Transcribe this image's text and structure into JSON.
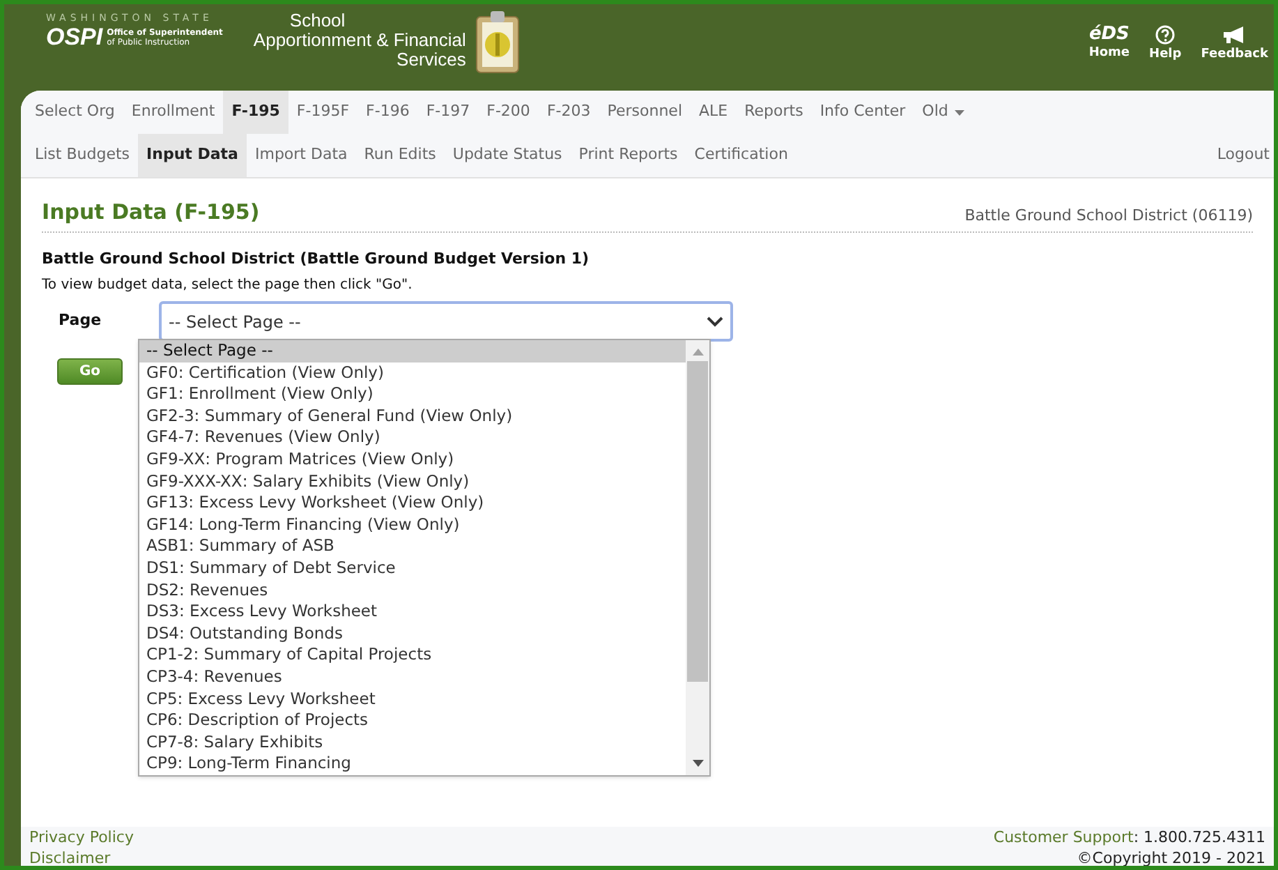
{
  "header": {
    "state_text": "WASHINGTON STATE",
    "logo": "OSPI",
    "agency_lines": [
      "Office of Superintendent",
      "of Public Instruction"
    ],
    "app_title_lines": [
      "School",
      "Apportionment & Financial",
      "Services"
    ],
    "eds_logo": "éDS",
    "links": [
      {
        "label": "Home",
        "kind": "home"
      },
      {
        "label": "Help",
        "kind": "help"
      },
      {
        "label": "Feedback",
        "kind": "feedback"
      }
    ]
  },
  "nav": [
    {
      "label": "Select Org",
      "selected": false
    },
    {
      "label": "Enrollment",
      "selected": false
    },
    {
      "label": "F-195",
      "selected": true
    },
    {
      "label": "F-195F",
      "selected": false
    },
    {
      "label": "F-196",
      "selected": false
    },
    {
      "label": "F-197",
      "selected": false
    },
    {
      "label": "F-200",
      "selected": false
    },
    {
      "label": "F-203",
      "selected": false
    },
    {
      "label": "Personnel",
      "selected": false
    },
    {
      "label": "ALE",
      "selected": false
    },
    {
      "label": "Reports",
      "selected": false
    },
    {
      "label": "Info Center",
      "selected": false
    },
    {
      "label": "Old",
      "selected": false,
      "menu": true
    }
  ],
  "subnav": [
    {
      "label": "List Budgets",
      "selected": false
    },
    {
      "label": "Input Data",
      "selected": true
    },
    {
      "label": "Import Data",
      "selected": false
    },
    {
      "label": "Run Edits",
      "selected": false
    },
    {
      "label": "Update Status",
      "selected": false
    },
    {
      "label": "Print Reports",
      "selected": false
    },
    {
      "label": "Certification",
      "selected": false
    }
  ],
  "logout": "Logout",
  "page": {
    "title": "Input Data (F-195)",
    "district": "Battle Ground School District (06119)",
    "budget": "Battle Ground School District (Battle Ground Budget Version 1)",
    "instruction": "To view budget data, select the page then click \"Go\".",
    "field_label": "Page",
    "select_value": "-- Select Page --",
    "go": "Go",
    "options": [
      {
        "label": "-- Select Page --",
        "selected": true
      },
      {
        "label": "GF0: Certification (View Only)",
        "selected": false
      },
      {
        "label": "GF1: Enrollment (View Only)",
        "selected": false
      },
      {
        "label": "GF2-3: Summary of General Fund (View Only)",
        "selected": false
      },
      {
        "label": "GF4-7: Revenues (View Only)",
        "selected": false
      },
      {
        "label": "GF9-XX: Program Matrices (View Only)",
        "selected": false
      },
      {
        "label": "GF9-XXX-XX: Salary Exhibits (View Only)",
        "selected": false
      },
      {
        "label": "GF13: Excess Levy Worksheet (View Only)",
        "selected": false
      },
      {
        "label": "GF14: Long-Term Financing (View Only)",
        "selected": false
      },
      {
        "label": "ASB1: Summary of ASB",
        "selected": false
      },
      {
        "label": "DS1: Summary of Debt Service",
        "selected": false
      },
      {
        "label": "DS2: Revenues",
        "selected": false
      },
      {
        "label": "DS3: Excess Levy Worksheet",
        "selected": false
      },
      {
        "label": "DS4: Outstanding Bonds",
        "selected": false
      },
      {
        "label": "CP1-2: Summary of Capital Projects",
        "selected": false
      },
      {
        "label": "CP3-4: Revenues",
        "selected": false
      },
      {
        "label": "CP5: Excess Levy Worksheet",
        "selected": false
      },
      {
        "label": "CP6: Description of Projects",
        "selected": false
      },
      {
        "label": "CP7-8: Salary Exhibits",
        "selected": false
      },
      {
        "label": "CP9: Long-Term Financing",
        "selected": false
      }
    ]
  },
  "footer": {
    "links": [
      "Privacy Policy",
      "Disclaimer"
    ],
    "support_label": "Customer Support",
    "support_number": ": 1.800.725.4311",
    "copyright": "©Copyright 2019 - 2021"
  }
}
